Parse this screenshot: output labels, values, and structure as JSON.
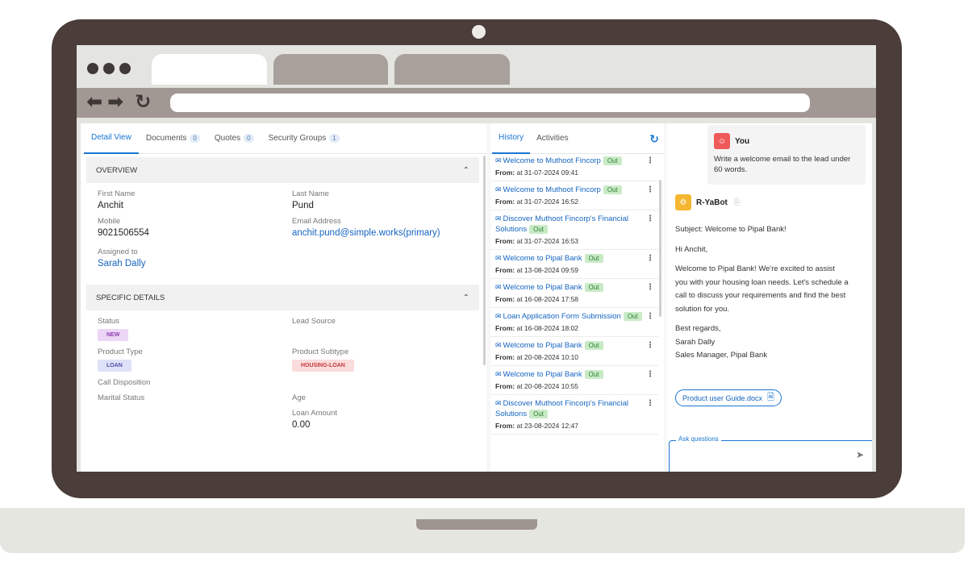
{
  "left_tabs": [
    {
      "label": "Detail View",
      "count": ""
    },
    {
      "label": "Documents",
      "count": "0"
    },
    {
      "label": "Quotes",
      "count": "0"
    },
    {
      "label": "Security Groups",
      "count": "1"
    }
  ],
  "overview": {
    "title": "OVERVIEW",
    "first_name_label": "First Name",
    "first_name": "Anchit",
    "last_name_label": "Last Name",
    "last_name": "Pund",
    "mobile_label": "Mobile",
    "mobile": "9021506554",
    "email_label": "Email Address",
    "email": "anchit.pund@simple.works(primary)",
    "assigned_label": "Assigned to",
    "assigned": "Sarah Dally"
  },
  "specific": {
    "title": "SPECIFIC DETAILS",
    "status_label": "Status",
    "status": "NEW",
    "lead_source_label": "Lead Source",
    "product_type_label": "Product Type",
    "product_type": "LOAN",
    "product_subtype_label": "Product Subtype",
    "product_subtype": "HOUSING-LOAN",
    "call_disposition_label": "Call Disposition",
    "marital_label": "Marital Status",
    "age_label": "Age",
    "loan_amount_label": "Loan Amount",
    "loan_amount": "0.00"
  },
  "mid_tabs": {
    "history": "History",
    "activities": "Activities"
  },
  "history": [
    {
      "title": "Welcome to Muthoot Fincorp",
      "tag": "Out",
      "from_label": "From:",
      "from": "at 31-07-2024 09:41"
    },
    {
      "title": "Welcome to Muthoot Fincorp",
      "tag": "Out",
      "from_label": "From:",
      "from": "at 31-07-2024 16:52"
    },
    {
      "title": "Discover Muthoot Fincorp's Financial Solutions",
      "tag": "Out",
      "from_label": "From:",
      "from": "at 31-07-2024 16:53"
    },
    {
      "title": "Welcome to Pipal Bank",
      "tag": "Out",
      "from_label": "From:",
      "from": "at 13-08-2024 09:59"
    },
    {
      "title": "Welcome to Pipal Bank",
      "tag": "Out",
      "from_label": "From:",
      "from": "at 16-08-2024 17:58"
    },
    {
      "title": "Loan Application Form Submission",
      "tag": "Out",
      "from_label": "From:",
      "from": "at 16-08-2024 18:02"
    },
    {
      "title": "Welcome to Pipal Bank",
      "tag": "Out",
      "from_label": "From:",
      "from": "at 20-08-2024 10:10"
    },
    {
      "title": "Welcome to Pipal Bank",
      "tag": "Out",
      "from_label": "From:",
      "from": "at 20-08-2024 10:55"
    },
    {
      "title": "Discover Muthoot Fincorp's Financial Solutions",
      "tag": "Out",
      "from_label": "From:",
      "from": "at 23-08-2024 12:47"
    }
  ],
  "chat": {
    "user_name": "You",
    "user_prompt": "Write a welcome email to the lead under 60 words.",
    "bot_name": "R-YaBot",
    "subject": "Subject: Welcome to Pipal Bank!",
    "greeting": "Hi Anchit,",
    "body": "Welcome to Pipal Bank! We're excited to assist you with your housing loan needs. Let's schedule a call to discuss your requirements and find the best solution for you.",
    "signoff": "Best regards,",
    "sig_name": "Sarah Dally",
    "sig_title": "Sales Manager, Pipal Bank",
    "attachment": "Product user Guide.docx",
    "ask_label": "Ask questions"
  },
  "colors": {
    "accent": "#1976d2",
    "bezel": "#4a3d3a",
    "out_tag": "#c8ebc6"
  },
  "icons": [
    "back-arrow-icon",
    "forward-arrow-icon",
    "reload-icon",
    "chevron-up-icon",
    "mail-icon",
    "kebab-icon",
    "refresh-icon",
    "user-icon",
    "bot-icon",
    "copy-icon",
    "file-icon",
    "send-icon"
  ]
}
